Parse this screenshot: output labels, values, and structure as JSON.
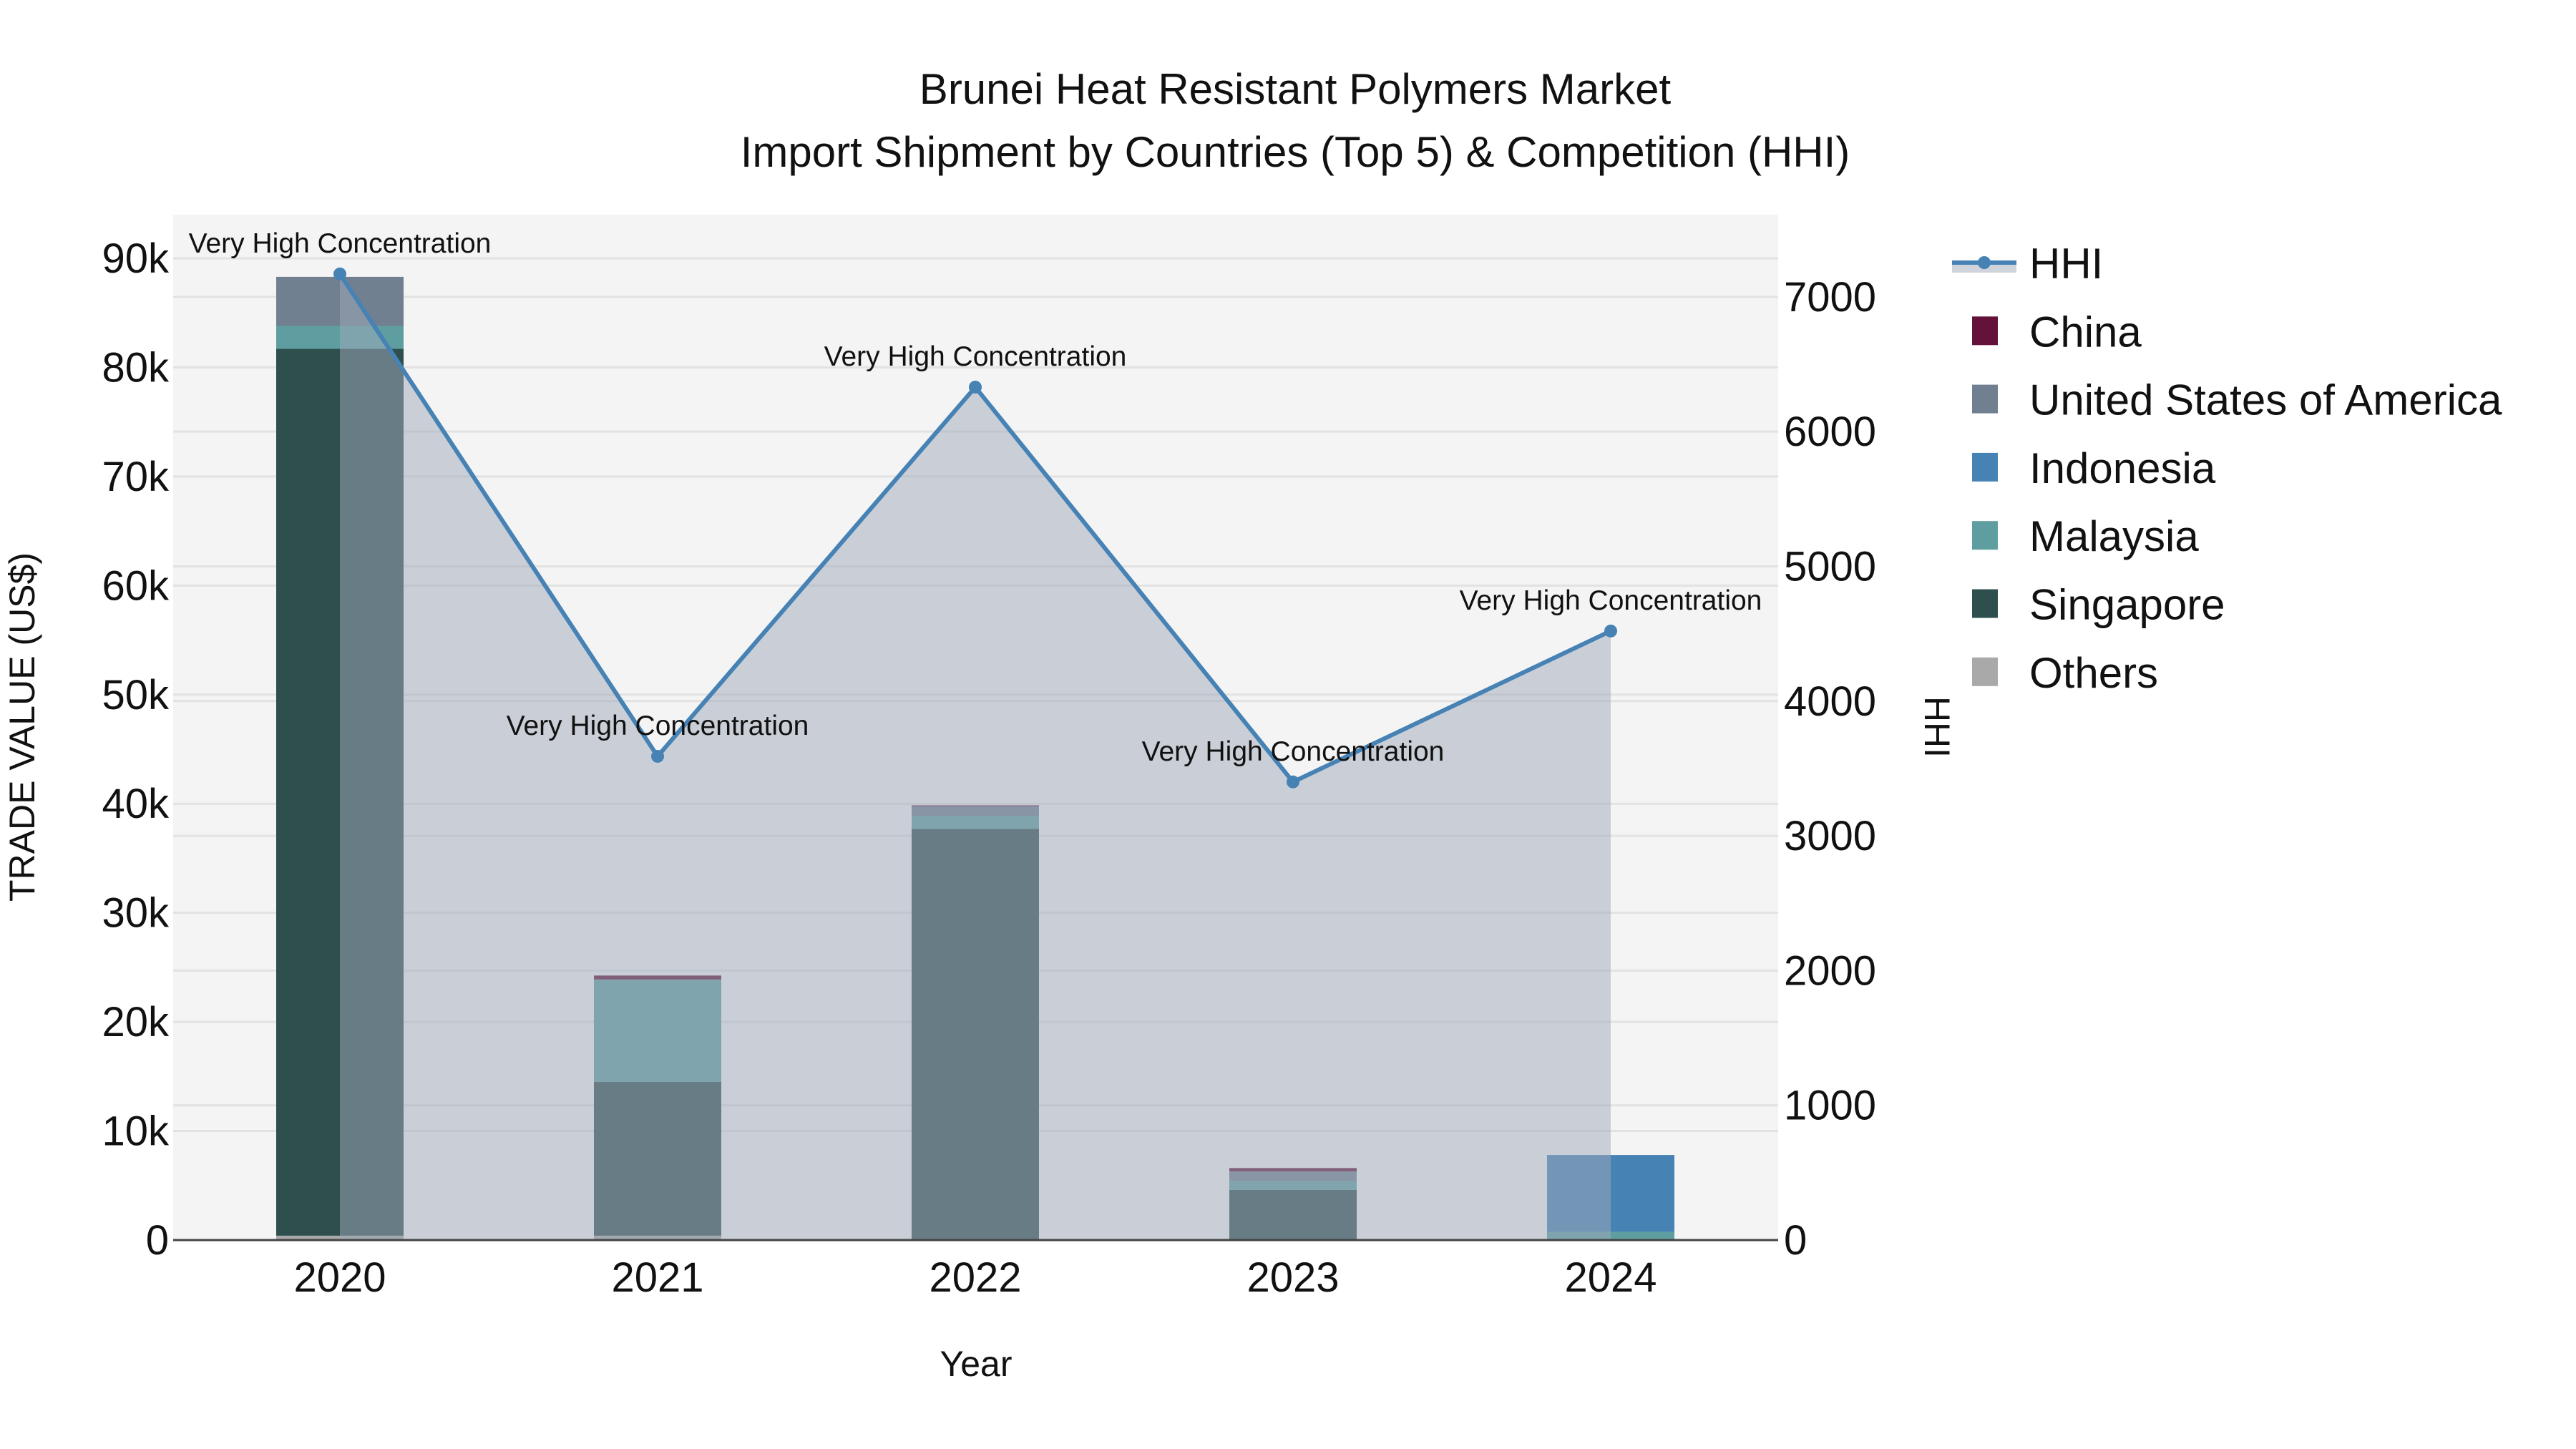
{
  "chart_data": {
    "type": "bar",
    "title": "Brunei Heat Resistant Polymers Market",
    "subtitle": "Import Shipment by Countries (Top 5) & Competition (HHI)",
    "xlabel": "Year",
    "ylabel": "TRADE VALUE (US$)",
    "y2label": "HHI",
    "categories": [
      "2020",
      "2021",
      "2022",
      "2023",
      "2024"
    ],
    "ylim": [
      0,
      94000
    ],
    "y2lim": [
      0,
      7610
    ],
    "yticks": [
      0,
      10000,
      20000,
      30000,
      40000,
      50000,
      60000,
      70000,
      80000,
      90000
    ],
    "ytick_labels": [
      "0",
      "10k",
      "20k",
      "30k",
      "40k",
      "50k",
      "60k",
      "70k",
      "80k",
      "90k"
    ],
    "y2ticks": [
      0,
      1000,
      2000,
      3000,
      4000,
      5000,
      6000,
      7000
    ],
    "y2tick_labels": [
      "0",
      "1000",
      "2000",
      "3000",
      "4000",
      "5000",
      "6000",
      "7000"
    ],
    "grid": true,
    "legend_placement": "right",
    "stacked": true,
    "series": [
      {
        "name": "Others",
        "color": "#a9a9a9",
        "values": [
          400,
          400,
          100,
          50,
          0
        ]
      },
      {
        "name": "Singapore",
        "color": "#2f4f4f",
        "values": [
          81300,
          14100,
          37600,
          4550,
          0
        ]
      },
      {
        "name": "Malaysia",
        "color": "#5f9ea0",
        "values": [
          2100,
          9300,
          1200,
          800,
          750
        ]
      },
      {
        "name": "Indonesia",
        "color": "#4682b4",
        "values": [
          0,
          0,
          0,
          0,
          7050
        ]
      },
      {
        "name": "United States of America",
        "color": "#708090",
        "values": [
          4500,
          100,
          900,
          900,
          0
        ]
      },
      {
        "name": "China",
        "color": "#63133a",
        "values": [
          0,
          350,
          50,
          300,
          0
        ]
      }
    ],
    "line_series": {
      "name": "HHI",
      "color": "#4682b4",
      "axis": "right",
      "values": [
        7170,
        3590,
        6330,
        3400,
        4520
      ],
      "annotations": [
        "Very High Concentration",
        "Very High Concentration",
        "Very High Concentration",
        "Very High Concentration",
        "Very High Concentration"
      ]
    },
    "legend": [
      "HHI",
      "China",
      "United States of America",
      "Indonesia",
      "Malaysia",
      "Singapore",
      "Others"
    ]
  }
}
